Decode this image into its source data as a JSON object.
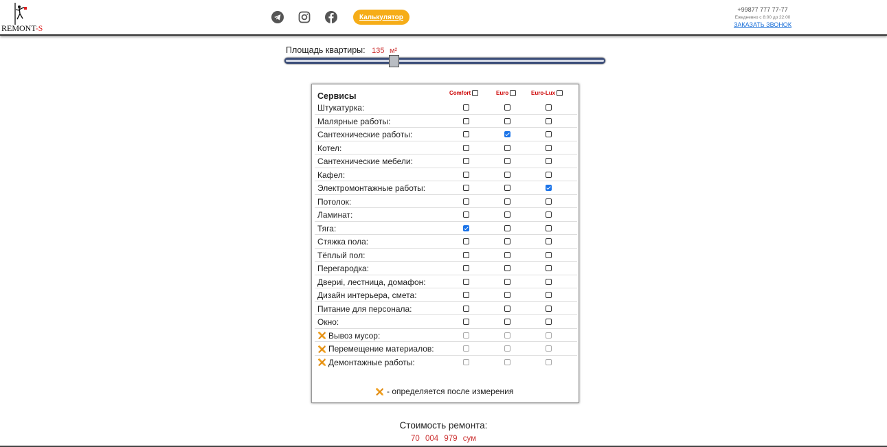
{
  "header": {
    "logo_text_main": "RE",
    "logo_text_mid": "M",
    "logo_text_tail": "ONT",
    "logo_text_accent": "-S",
    "social": [
      "telegram-icon",
      "instagram-icon",
      "facebook-icon"
    ],
    "calc_button_label": "Калькулятор",
    "phone": "+99877 777 77-77",
    "hours": "Ежедневно с 8:00 до 22:00",
    "callback_link": "ЗАКАЗАТЬ ЗВОНОК"
  },
  "area": {
    "label": "Площадь квартиры:",
    "value": "135",
    "unit": "м²",
    "slider_fraction": 0.34
  },
  "services": {
    "title": "Сервисы",
    "columns": [
      "Comfort",
      "Euro",
      "Euro-Lux"
    ],
    "rows": [
      {
        "label": "Штукатурка:",
        "checks": [
          false,
          false,
          false
        ],
        "measure": false
      },
      {
        "label": "Малярные работы:",
        "checks": [
          false,
          false,
          false
        ],
        "measure": false
      },
      {
        "label": "Сантехнические работы:",
        "checks": [
          false,
          true,
          false
        ],
        "measure": false
      },
      {
        "label": "Котел:",
        "checks": [
          false,
          false,
          false
        ],
        "measure": false
      },
      {
        "label": "Сантехнические мебели:",
        "checks": [
          false,
          false,
          false
        ],
        "measure": false
      },
      {
        "label": "Кафел:",
        "checks": [
          false,
          false,
          false
        ],
        "measure": false
      },
      {
        "label": "Электромонтажные работы:",
        "checks": [
          false,
          false,
          true
        ],
        "measure": false
      },
      {
        "label": "Потолок:",
        "checks": [
          false,
          false,
          false
        ],
        "measure": false
      },
      {
        "label": "Ламинат:",
        "checks": [
          false,
          false,
          false
        ],
        "measure": false
      },
      {
        "label": "Тяга:",
        "checks": [
          true,
          false,
          false
        ],
        "measure": false
      },
      {
        "label": "Стяжка пола:",
        "checks": [
          false,
          false,
          false
        ],
        "measure": false
      },
      {
        "label": "Тёплый пол:",
        "checks": [
          false,
          false,
          false
        ],
        "measure": false
      },
      {
        "label": "Перегародка:",
        "checks": [
          false,
          false,
          false
        ],
        "measure": false
      },
      {
        "label": "Двериi, лестница, домафон:",
        "checks": [
          false,
          false,
          false
        ],
        "measure": false
      },
      {
        "label": "Дизайн интерьера, смета:",
        "checks": [
          false,
          false,
          false
        ],
        "measure": false
      },
      {
        "label": "Питание для персонала:",
        "checks": [
          false,
          false,
          false
        ],
        "measure": false
      },
      {
        "label": "Окно:",
        "checks": [
          false,
          false,
          false
        ],
        "measure": false
      },
      {
        "label": "Вывоз мусор:",
        "checks": [
          false,
          false,
          false
        ],
        "measure": true
      },
      {
        "label": "Перемещение материалов:",
        "checks": [
          false,
          false,
          false
        ],
        "measure": true
      },
      {
        "label": "Демонтажные работы:",
        "checks": [
          false,
          false,
          false
        ],
        "measure": true
      }
    ],
    "note": "- определяется после измерения"
  },
  "total": {
    "label": "Стоимость ремонта:",
    "value": "70 004 979 сум"
  },
  "colors": {
    "accent_orange": "#f6ad18",
    "price_red": "#cc3333",
    "link_blue": "#1a6fd8",
    "check_blue": "#1a73e8"
  }
}
